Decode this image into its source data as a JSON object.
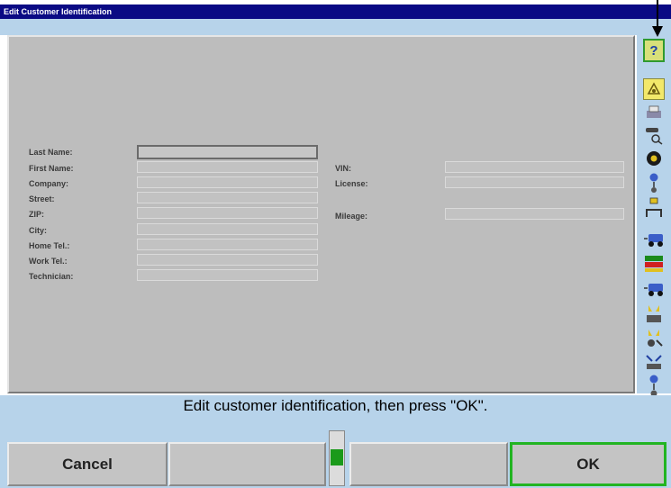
{
  "window": {
    "title": "Edit Customer Identification"
  },
  "form": {
    "left_fields": [
      {
        "label": "Last Name:",
        "value": ""
      },
      {
        "label": "First Name:",
        "value": ""
      },
      {
        "label": "Company:",
        "value": ""
      },
      {
        "label": "Street:",
        "value": ""
      },
      {
        "label": "ZIP:",
        "value": ""
      },
      {
        "label": "City:",
        "value": ""
      },
      {
        "label": "Home Tel.:",
        "value": ""
      },
      {
        "label": "Work Tel.:",
        "value": ""
      },
      {
        "label": "Technician:",
        "value": ""
      }
    ],
    "right_fields": [
      {
        "label": "VIN:",
        "value": ""
      },
      {
        "label": "License:",
        "value": ""
      },
      {
        "label": "Mileage:",
        "value": ""
      }
    ]
  },
  "toolbar": {
    "help_label": "?",
    "icons": [
      "help-icon",
      "notes-icon",
      "printer-icon",
      "vehicle-search-icon",
      "wheel-icon",
      "alignment-icon",
      "lift-icon",
      "vehicle-side-icon",
      "specifications-icon",
      "vehicle-rear-icon",
      "axle-icon",
      "axle-icon-2",
      "steering-icon",
      "wheel-adjust-icon"
    ]
  },
  "status": {
    "message": "Edit customer identification, then press \"OK\"."
  },
  "buttons": {
    "cancel_label": "Cancel",
    "ok_label": "OK"
  },
  "colors": {
    "title_bar": "#0a0a84",
    "panel_gray": "#bdbdbd",
    "frame_blue": "#b7d3ea",
    "ok_border": "#22b422",
    "indicator_green": "#1a9a1a"
  }
}
